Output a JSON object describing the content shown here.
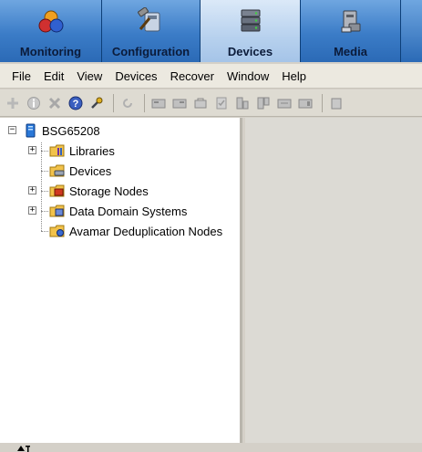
{
  "nav": {
    "tabs": [
      {
        "label": "Monitoring",
        "icon": "monitoring-icon",
        "active": false
      },
      {
        "label": "Configuration",
        "icon": "configuration-icon",
        "active": false
      },
      {
        "label": "Devices",
        "icon": "devices-icon",
        "active": true
      },
      {
        "label": "Media",
        "icon": "media-icon",
        "active": false
      }
    ]
  },
  "menu": {
    "items": [
      "File",
      "Edit",
      "View",
      "Devices",
      "Recover",
      "Window",
      "Help"
    ]
  },
  "toolbar": {
    "icons": [
      "add-icon",
      "info-icon",
      "delete-icon",
      "help-icon",
      "wrench-icon",
      "refresh-icon",
      "device-action-icon-1",
      "device-action-icon-2",
      "device-action-icon-3",
      "device-action-icon-4",
      "device-action-icon-5",
      "device-action-icon-6",
      "device-action-icon-7",
      "device-action-icon-8",
      "device-action-icon-9"
    ]
  },
  "tree": {
    "root": {
      "label": "BSG65208",
      "icon": "server-icon",
      "expanded": true
    },
    "children": [
      {
        "label": "Libraries",
        "icon": "libraries-folder-icon",
        "expandable": true
      },
      {
        "label": "Devices",
        "icon": "devices-folder-icon",
        "expandable": false
      },
      {
        "label": "Storage Nodes",
        "icon": "storage-nodes-folder-icon",
        "expandable": true
      },
      {
        "label": "Data Domain Systems",
        "icon": "data-domain-folder-icon",
        "expandable": true
      },
      {
        "label": "Avamar Deduplication Nodes",
        "icon": "avamar-folder-icon",
        "expandable": false
      }
    ]
  },
  "colors": {
    "nav_bg": "#3b7cc7",
    "nav_active_bg": "#b7d1ee",
    "menubar_bg": "#ece9e0",
    "tree_bg": "#ffffff",
    "right_panel_bg": "#dcdad4"
  }
}
